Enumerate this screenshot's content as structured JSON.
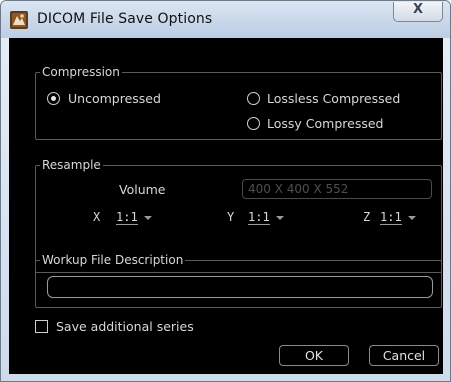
{
  "window": {
    "title": "DICOM File Save Options",
    "close_glyph": "X",
    "app_icon": "dicom-app-icon"
  },
  "compression": {
    "legend": "Compression",
    "options": [
      {
        "label": "Uncompressed",
        "selected": true
      },
      {
        "label": "Lossless Compressed",
        "selected": false
      },
      {
        "label": "Lossy Compressed",
        "selected": false
      }
    ]
  },
  "resample": {
    "legend": "Resample",
    "volume_label": "Volume",
    "volume_value": "400 X 400 X 552",
    "x_label": "X",
    "x_value": "1:1",
    "y_label": "Y",
    "y_value": "1:1",
    "z_label": "Z",
    "z_value": "1:1"
  },
  "workup": {
    "legend": "Workup File Description",
    "value": ""
  },
  "save_series": {
    "label": "Save additional series",
    "checked": false
  },
  "buttons": {
    "ok": "OK",
    "cancel": "Cancel"
  }
}
